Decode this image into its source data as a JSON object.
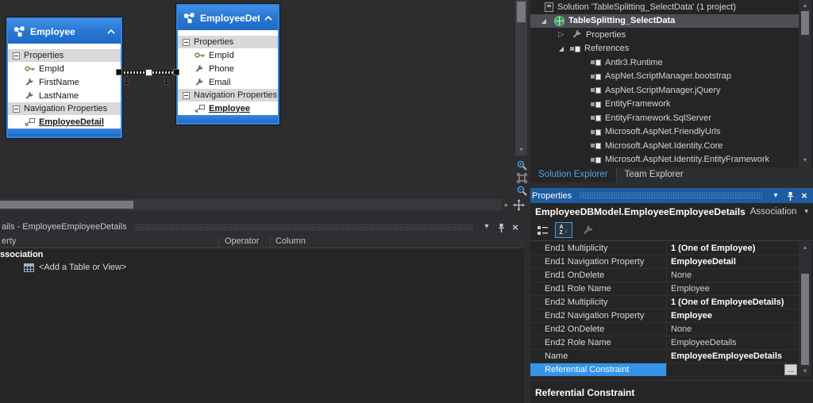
{
  "colors": {
    "background": "#2d2d30",
    "panel": "#252526",
    "entity_header_blue": "#2a78d4",
    "panel_title_blue": "#1d5c9f",
    "selection_blue": "#3394e8",
    "active_tab_text": "#4ba3e8"
  },
  "designer": {
    "entities": [
      {
        "title": "Employee",
        "properties_section_label": "Properties",
        "navigation_section_label": "Navigation Properties",
        "properties": [
          {
            "label": "EmpId",
            "icon": "key-icon"
          },
          {
            "label": "FirstName",
            "icon": "wrench-icon"
          },
          {
            "label": "LastName",
            "icon": "wrench-icon"
          }
        ],
        "navigation_properties": [
          {
            "label": "EmployeeDetail",
            "icon": "navigation-property-icon"
          }
        ]
      },
      {
        "title": "EmployeeDet...",
        "properties_section_label": "Properties",
        "navigation_section_label": "Navigation Properties",
        "properties": [
          {
            "label": "EmpId",
            "icon": "key-icon"
          },
          {
            "label": "Phone",
            "icon": "wrench-icon"
          },
          {
            "label": "Email",
            "icon": "wrench-icon"
          }
        ],
        "navigation_properties": [
          {
            "label": "Employee",
            "icon": "navigation-property-icon"
          }
        ]
      }
    ],
    "association": {
      "end1_multiplicity": "1",
      "end2_multiplicity": "1"
    }
  },
  "mapping_details": {
    "title": "ails - EmployeeEmployeeDetails",
    "columns": {
      "property": "erty",
      "operator": "Operator",
      "column": "Column"
    },
    "group_row": "ssociation",
    "add_row": "<Add a Table or View>"
  },
  "solution_explorer": {
    "items": [
      {
        "label": "Solution 'TableSplitting_SelectData' (1 project)"
      },
      {
        "label": "TableSplitting_SelectData"
      },
      {
        "label": "Properties"
      },
      {
        "label": "References"
      },
      {
        "label": "Antlr3.Runtime"
      },
      {
        "label": "AspNet.ScriptManager.bootstrap"
      },
      {
        "label": "AspNet.ScriptManager.jQuery"
      },
      {
        "label": "EntityFramework"
      },
      {
        "label": "EntityFramework.SqlServer"
      },
      {
        "label": "Microsoft.AspNet.FriendlyUrls"
      },
      {
        "label": "Microsoft.AspNet.Identity.Core"
      },
      {
        "label": "Microsoft.AspNet.Identity.EntityFramework"
      }
    ],
    "tabs": [
      {
        "label": "Solution Explorer",
        "active": true
      },
      {
        "label": "Team Explorer",
        "active": false
      }
    ]
  },
  "properties_panel": {
    "title": "Properties",
    "object_name": "EmployeeDBModel.EmployeeEmployeeDetails",
    "object_type": "Association",
    "rows": [
      {
        "name": "End1 Multiplicity",
        "value": "1 (One of Employee)"
      },
      {
        "name": "End1 Navigation Property",
        "value": "EmployeeDetail"
      },
      {
        "name": "End1 OnDelete",
        "value": "None"
      },
      {
        "name": "End1 Role Name",
        "value": "Employee"
      },
      {
        "name": "End2 Multiplicity",
        "value": "1 (One of EmployeeDetails)"
      },
      {
        "name": "End2 Navigation Property",
        "value": "Employee"
      },
      {
        "name": "End2 OnDelete",
        "value": "None"
      },
      {
        "name": "End2 Role Name",
        "value": "EmployeeDetails"
      },
      {
        "name": "Name",
        "value": "EmployeeEmployeeDetails"
      },
      {
        "name": "Referential Constraint",
        "value": "",
        "ellipsis": "..."
      }
    ],
    "description_title": "Referential Constraint"
  }
}
